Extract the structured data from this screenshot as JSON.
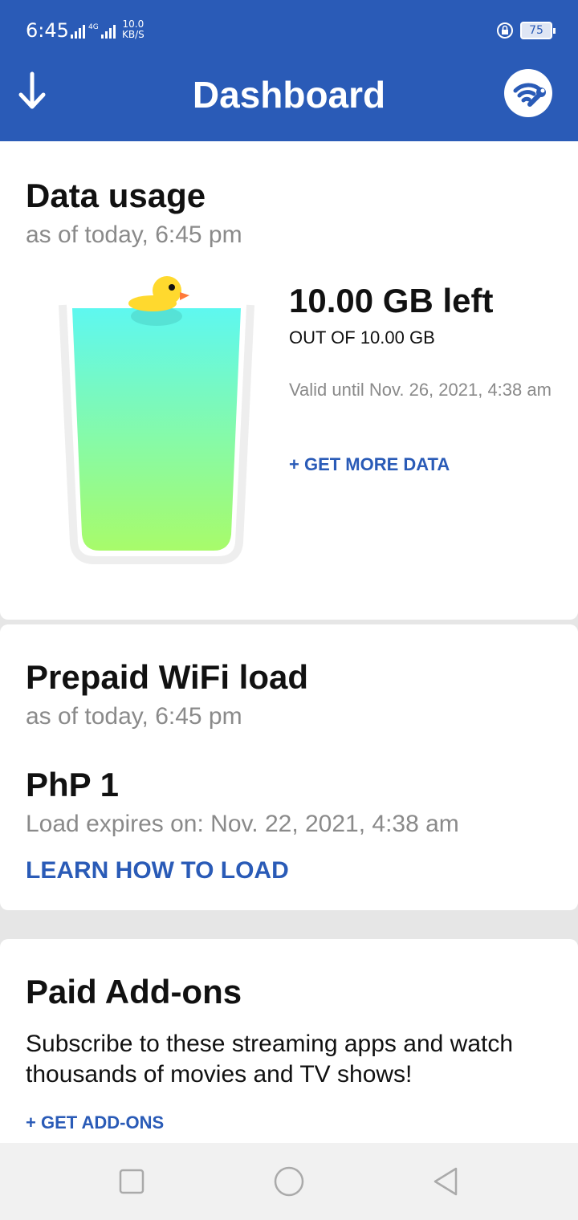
{
  "status": {
    "time": "6:45",
    "network": "4G",
    "speed_value": "10.0",
    "speed_unit": "KB/S",
    "battery": "75"
  },
  "header": {
    "title": "Dashboard",
    "left_icon": "arrow-down-icon",
    "right_icon": "wifi-wrench-icon"
  },
  "data_usage": {
    "title": "Data usage",
    "asof": "as of today, 6:45 pm",
    "left": "10.00 GB left",
    "outof": "OUT OF 10.00 GB",
    "valid": "Valid until Nov. 26, 2021, 4:38 am",
    "cta": "+ GET MORE DATA",
    "level_fraction": 1.0
  },
  "prepaid": {
    "title": "Prepaid WiFi load",
    "asof": "as of today, 6:45 pm",
    "amount": "PhP 1",
    "expires": "Load expires on: Nov. 22, 2021, 4:38 am",
    "cta": "LEARN HOW TO LOAD"
  },
  "addons": {
    "title": "Paid Add-ons",
    "description": "Subscribe to these streaming apps and watch thousands of movies and TV shows!",
    "cta": "+ GET ADD-ONS"
  },
  "colors": {
    "primary": "#2a5bb7",
    "glass_top": "#5ef8f0",
    "glass_bottom": "#a8fb6a",
    "duck": "#ffd92e"
  }
}
